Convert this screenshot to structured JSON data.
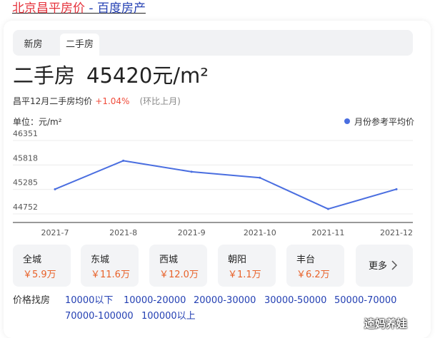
{
  "header": {
    "title_main": "北京昌平房价",
    "title_sep": " - ",
    "title_source": "百度房产"
  },
  "tabs": [
    {
      "label": "新房",
      "active": false
    },
    {
      "label": "二手房",
      "active": true
    }
  ],
  "summary": {
    "type_label": "二手房",
    "price": "45420元/m²",
    "subtitle": "昌平12月二手房均价",
    "change": "+1.04%",
    "change_note": "(环比上月)"
  },
  "chart_header": {
    "unit": "单位：元/m²",
    "legend": "月份参考平均价"
  },
  "chart_data": {
    "type": "line",
    "x": [
      "2021-7",
      "2021-8",
      "2021-9",
      "2021-10",
      "2021-11",
      "2021-12"
    ],
    "series": [
      {
        "name": "月份参考平均价",
        "values": [
          45290,
          45910,
          45670,
          45540,
          44860,
          45290
        ]
      }
    ],
    "yticks": [
      46351,
      45818,
      45285,
      44752
    ],
    "ylim": [
      44752,
      46351
    ],
    "color": "#4a6ee0",
    "grid": true
  },
  "districts": [
    {
      "name": "全城",
      "price": "￥5.9万"
    },
    {
      "name": "东城",
      "price": "￥11.6万"
    },
    {
      "name": "西城",
      "price": "￥12.0万"
    },
    {
      "name": "朝阳",
      "price": "￥1.1万"
    },
    {
      "name": "丰台",
      "price": "￥6.2万"
    }
  ],
  "more_label": "更多",
  "price_filter": {
    "label": "价格找房",
    "ranges": [
      "10000以下",
      "10000-20000",
      "20000-30000",
      "30000-50000",
      "50000-70000",
      "70000-100000",
      "100000以上"
    ]
  },
  "watermark": "逵妈养娃"
}
